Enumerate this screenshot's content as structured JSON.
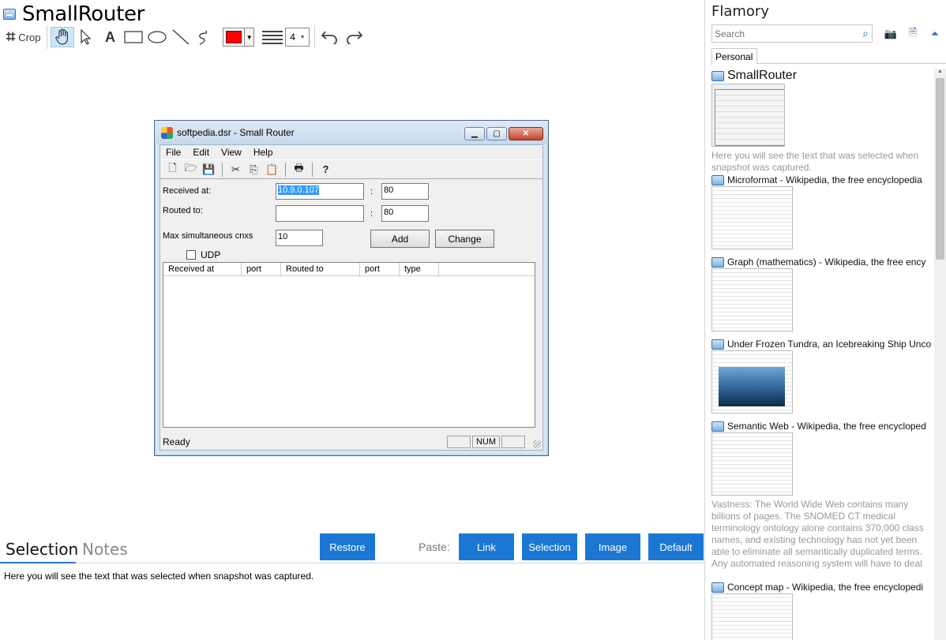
{
  "app": {
    "title": "SmallRouter"
  },
  "toolbar": {
    "crop_label": "Crop",
    "text_tool_label": "A",
    "line_width_value": "4",
    "color": "#ff0000"
  },
  "router_window": {
    "title": "softpedia.dsr - Small Router",
    "menu": [
      "File",
      "Edit",
      "View",
      "Help"
    ],
    "received_at_label": "Received at:",
    "received_at_ip": "10.9.0.107",
    "received_at_port": "80",
    "routed_to_label": "Routed to:",
    "routed_to_ip": "",
    "routed_to_port": "80",
    "colon": ":",
    "max_cnxs_label": "Max simultaneous cnxs",
    "max_cnxs_value": "10",
    "add_label": "Add",
    "change_label": "Change",
    "udp_label": "UDP",
    "columns": [
      "Received at",
      "port",
      "Routed to",
      "port",
      "type"
    ],
    "status_text": "Ready",
    "status_num": "NUM"
  },
  "bottom": {
    "tab_selection": "Selection",
    "tab_notes": "Notes",
    "restore_label": "Restore",
    "paste_label": "Paste:",
    "link_label": "Link",
    "selection_label": "Selection",
    "image_label": "Image",
    "default_label": "Default",
    "selection_text": "Here you will see the text that was selected when snapshot was captured."
  },
  "sidebar": {
    "title": "Flamory",
    "search_placeholder": "Search",
    "tab_personal": "Personal",
    "items": [
      {
        "title": "SmallRouter",
        "desc": "Here you will see the text that was selected when snapshot was captured."
      },
      {
        "title": "Microformat - Wikipedia, the free encyclopedia"
      },
      {
        "title": "Graph (mathematics) - Wikipedia, the free ency"
      },
      {
        "title": "Under Frozen Tundra, an Icebreaking Ship Unco"
      },
      {
        "title": "Semantic Web - Wikipedia, the free encycloped",
        "desc": "Vastness: The World Wide Web contains many billions of pages. The SNOMED CT medical terminology ontology alone contains 370,000 class names, and existing technology has not yet been able to eliminate all semantically duplicated terms. Any automated reasoning system will have to deal with truly huge inputs."
      },
      {
        "title": "Concept map - Wikipedia, the free encyclopedi"
      }
    ]
  }
}
